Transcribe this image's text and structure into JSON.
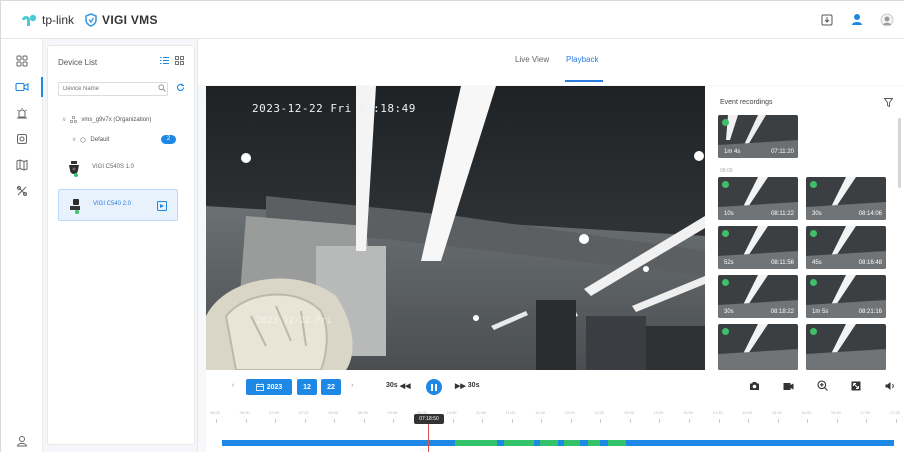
{
  "app": {
    "brand": "tp-link",
    "product": "VIGI VMS"
  },
  "device_panel": {
    "title": "Device List",
    "search_placeholder": "Device Name",
    "organization": "vms_g9v7x (Organization)",
    "group": "Default",
    "group_count": "2",
    "devices": [
      {
        "name": "VIGI C540S 1.0",
        "selected": false
      },
      {
        "name": "VIGI C540 2.0",
        "selected": true
      }
    ]
  },
  "tabs": {
    "live_view": "Live View",
    "playback": "Playback",
    "active": "Playback"
  },
  "video": {
    "osd_time": "2023-12-22 Fri 07:18:49",
    "osd_watermark": "2023-12-22 Fri"
  },
  "events": {
    "title": "Event recordings",
    "date_header": "08:00",
    "items": [
      {
        "duration": "1m 4s",
        "time": "07:11:20"
      },
      {
        "duration": "10s",
        "time": "08:11:22"
      },
      {
        "duration": "30s",
        "time": "08:14:06"
      },
      {
        "duration": "52s",
        "time": "08:11:56"
      },
      {
        "duration": "45s",
        "time": "08:16:48"
      },
      {
        "duration": "30s",
        "time": "08:18:22"
      },
      {
        "duration": "1m 5s",
        "time": "08:21:16"
      },
      {
        "duration": "",
        "time": ""
      },
      {
        "duration": "",
        "time": ""
      }
    ]
  },
  "controls": {
    "year": "2023",
    "month": "12",
    "day": "22",
    "rewind": "30s",
    "forward": "30s"
  },
  "timeline": {
    "cursor_time": "07:18:50",
    "tick_labels": [
      "06:00",
      "06:30",
      "07:00",
      "07:30",
      "08:00",
      "08:30",
      "09:00",
      "09:30",
      "10:00",
      "10:30",
      "11:00",
      "11:30",
      "12:00",
      "12:30",
      "13:00",
      "13:30",
      "14:00",
      "14:30",
      "15:00",
      "15:30",
      "16:00",
      "16:30",
      "17:00",
      "17:30"
    ]
  },
  "colors": {
    "accent": "#1e88e5",
    "event_green": "#34c26b",
    "online": "#37c26b"
  }
}
